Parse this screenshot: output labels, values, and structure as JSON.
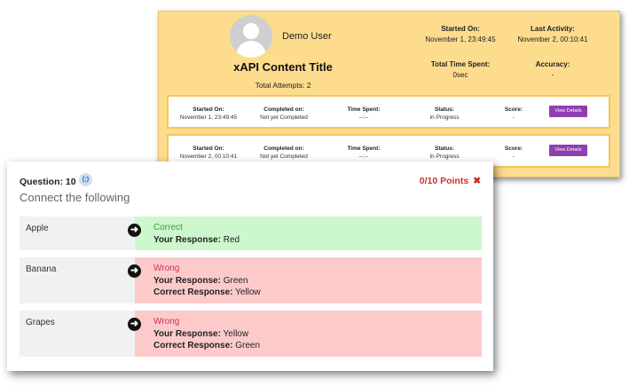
{
  "summary": {
    "user_name": "Demo User",
    "content_title": "xAPI Content Title",
    "total_attempts": "Total Attempts: 2",
    "started_on_label": "Started On:",
    "started_on_value": "November 1, 23:49:45",
    "last_activity_label": "Last Activity:",
    "last_activity_value": "November 2, 00:10:41",
    "total_time_label": "Total Time Spent:",
    "total_time_value": "0sec",
    "accuracy_label": "Accuracy:",
    "accuracy_value": "-",
    "attempts": [
      {
        "started_label": "Started On:",
        "started_value": "November 1, 23:49:45",
        "completed_label": "Completed on:",
        "completed_value": "Not yet Completed",
        "time_label": "Time Spent:",
        "time_value": "--:--",
        "status_label": "Status:",
        "status_value": "In Progress",
        "score_label": "Score:",
        "score_value": "-",
        "button_label": "View Details"
      },
      {
        "started_label": "Started On:",
        "started_value": "November 2, 00:10:41",
        "completed_label": "Completed on:",
        "completed_value": "Not yet Completed",
        "time_label": "Time Spent:",
        "time_value": "--:--",
        "status_label": "Status:",
        "status_value": "In Progress",
        "score_label": "Score:",
        "score_value": "-",
        "button_label": "View Details"
      }
    ]
  },
  "question": {
    "label": "Question: 10",
    "badge": "{;}",
    "points": "0/10 Points",
    "points_icon": "✖",
    "text": "Connect the following",
    "rows": [
      {
        "item": "Apple",
        "status": "Correct",
        "your_response_label": "Your Response:",
        "your_response": "Red"
      },
      {
        "item": "Banana",
        "status": "Wrong",
        "your_response_label": "Your Response:",
        "your_response": "Green",
        "correct_response_label": "Correct Response:",
        "correct_response": "Yellow"
      },
      {
        "item": "Grapes",
        "status": "Wrong",
        "your_response_label": "Your Response:",
        "your_response": "Yellow",
        "correct_response_label": "Correct Response:",
        "correct_response": "Green"
      }
    ]
  },
  "colors": {
    "summary_bg": "#fddc8d",
    "button": "#8e3fb0",
    "correct_bg": "#cdf7cc",
    "wrong_bg": "#fdcaca",
    "points": "#d12e2e"
  },
  "icons": {
    "avatar": "user-avatar-icon",
    "arrow": "arrow-right-circle-icon",
    "points": "close-x-icon"
  }
}
